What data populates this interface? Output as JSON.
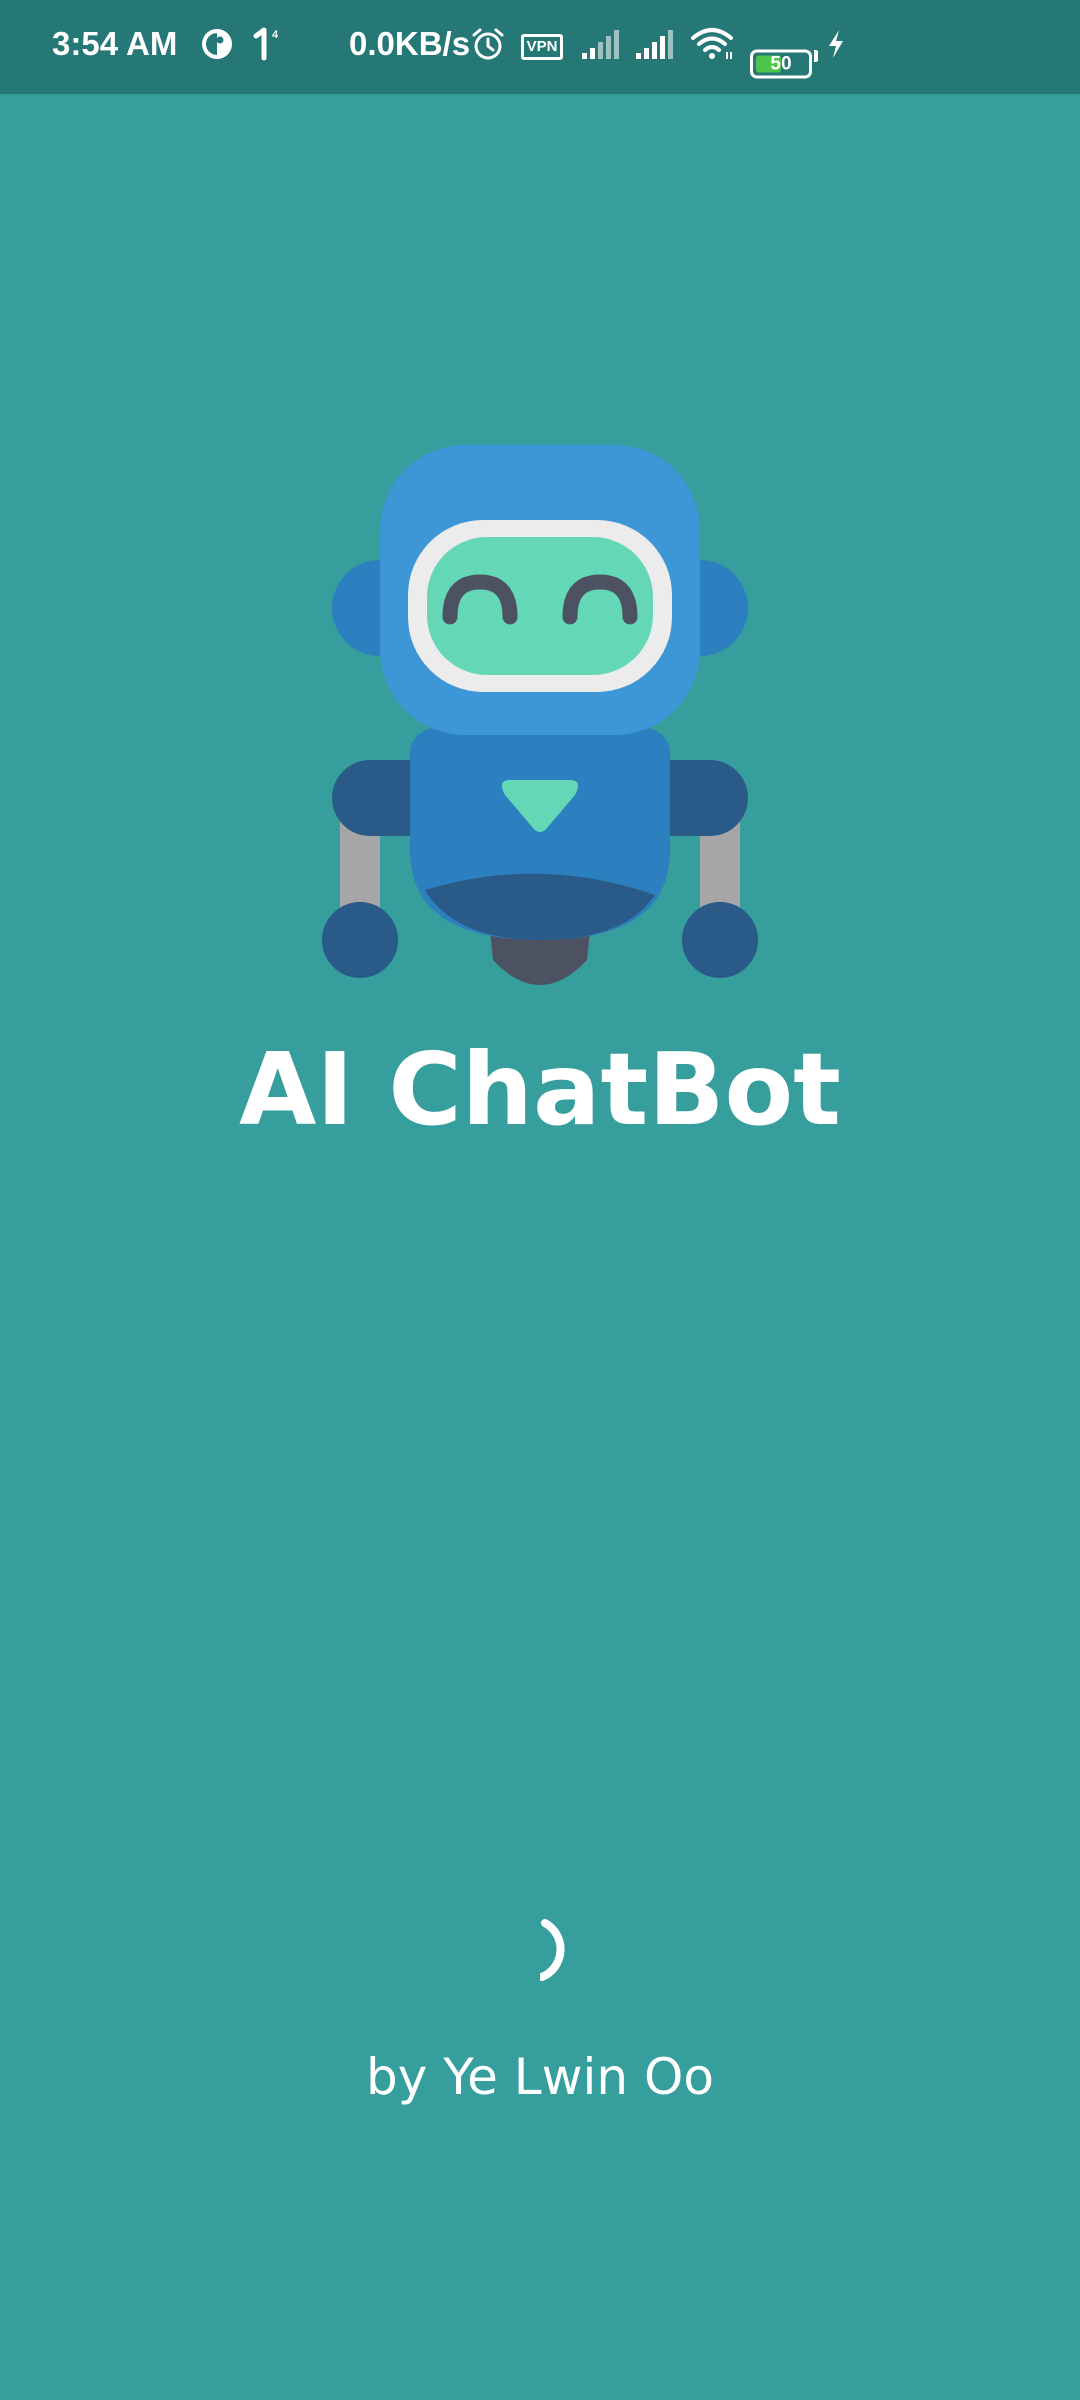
{
  "status_bar": {
    "time": "3:54 AM",
    "network_speed": "0.0KB/s",
    "vpn_label": "VPN",
    "battery_level": "50",
    "battery_fraction": 0.5,
    "icons": [
      "app-notification-icon",
      "signal-notification-icon",
      "alarm-icon",
      "vpn-icon",
      "cell-signal-icon",
      "cell-signal-icon",
      "wifi-icon",
      "battery-icon",
      "charging-bolt-icon"
    ]
  },
  "splash": {
    "app_title": "AI ChatBot",
    "author": "by Ye Lwin Oo",
    "logo_icon": "robot-icon",
    "loading_indicator": "spinner-icon"
  },
  "colors": {
    "background": "#369e9d",
    "status_bar": "#267877",
    "text": "#ffffff"
  }
}
